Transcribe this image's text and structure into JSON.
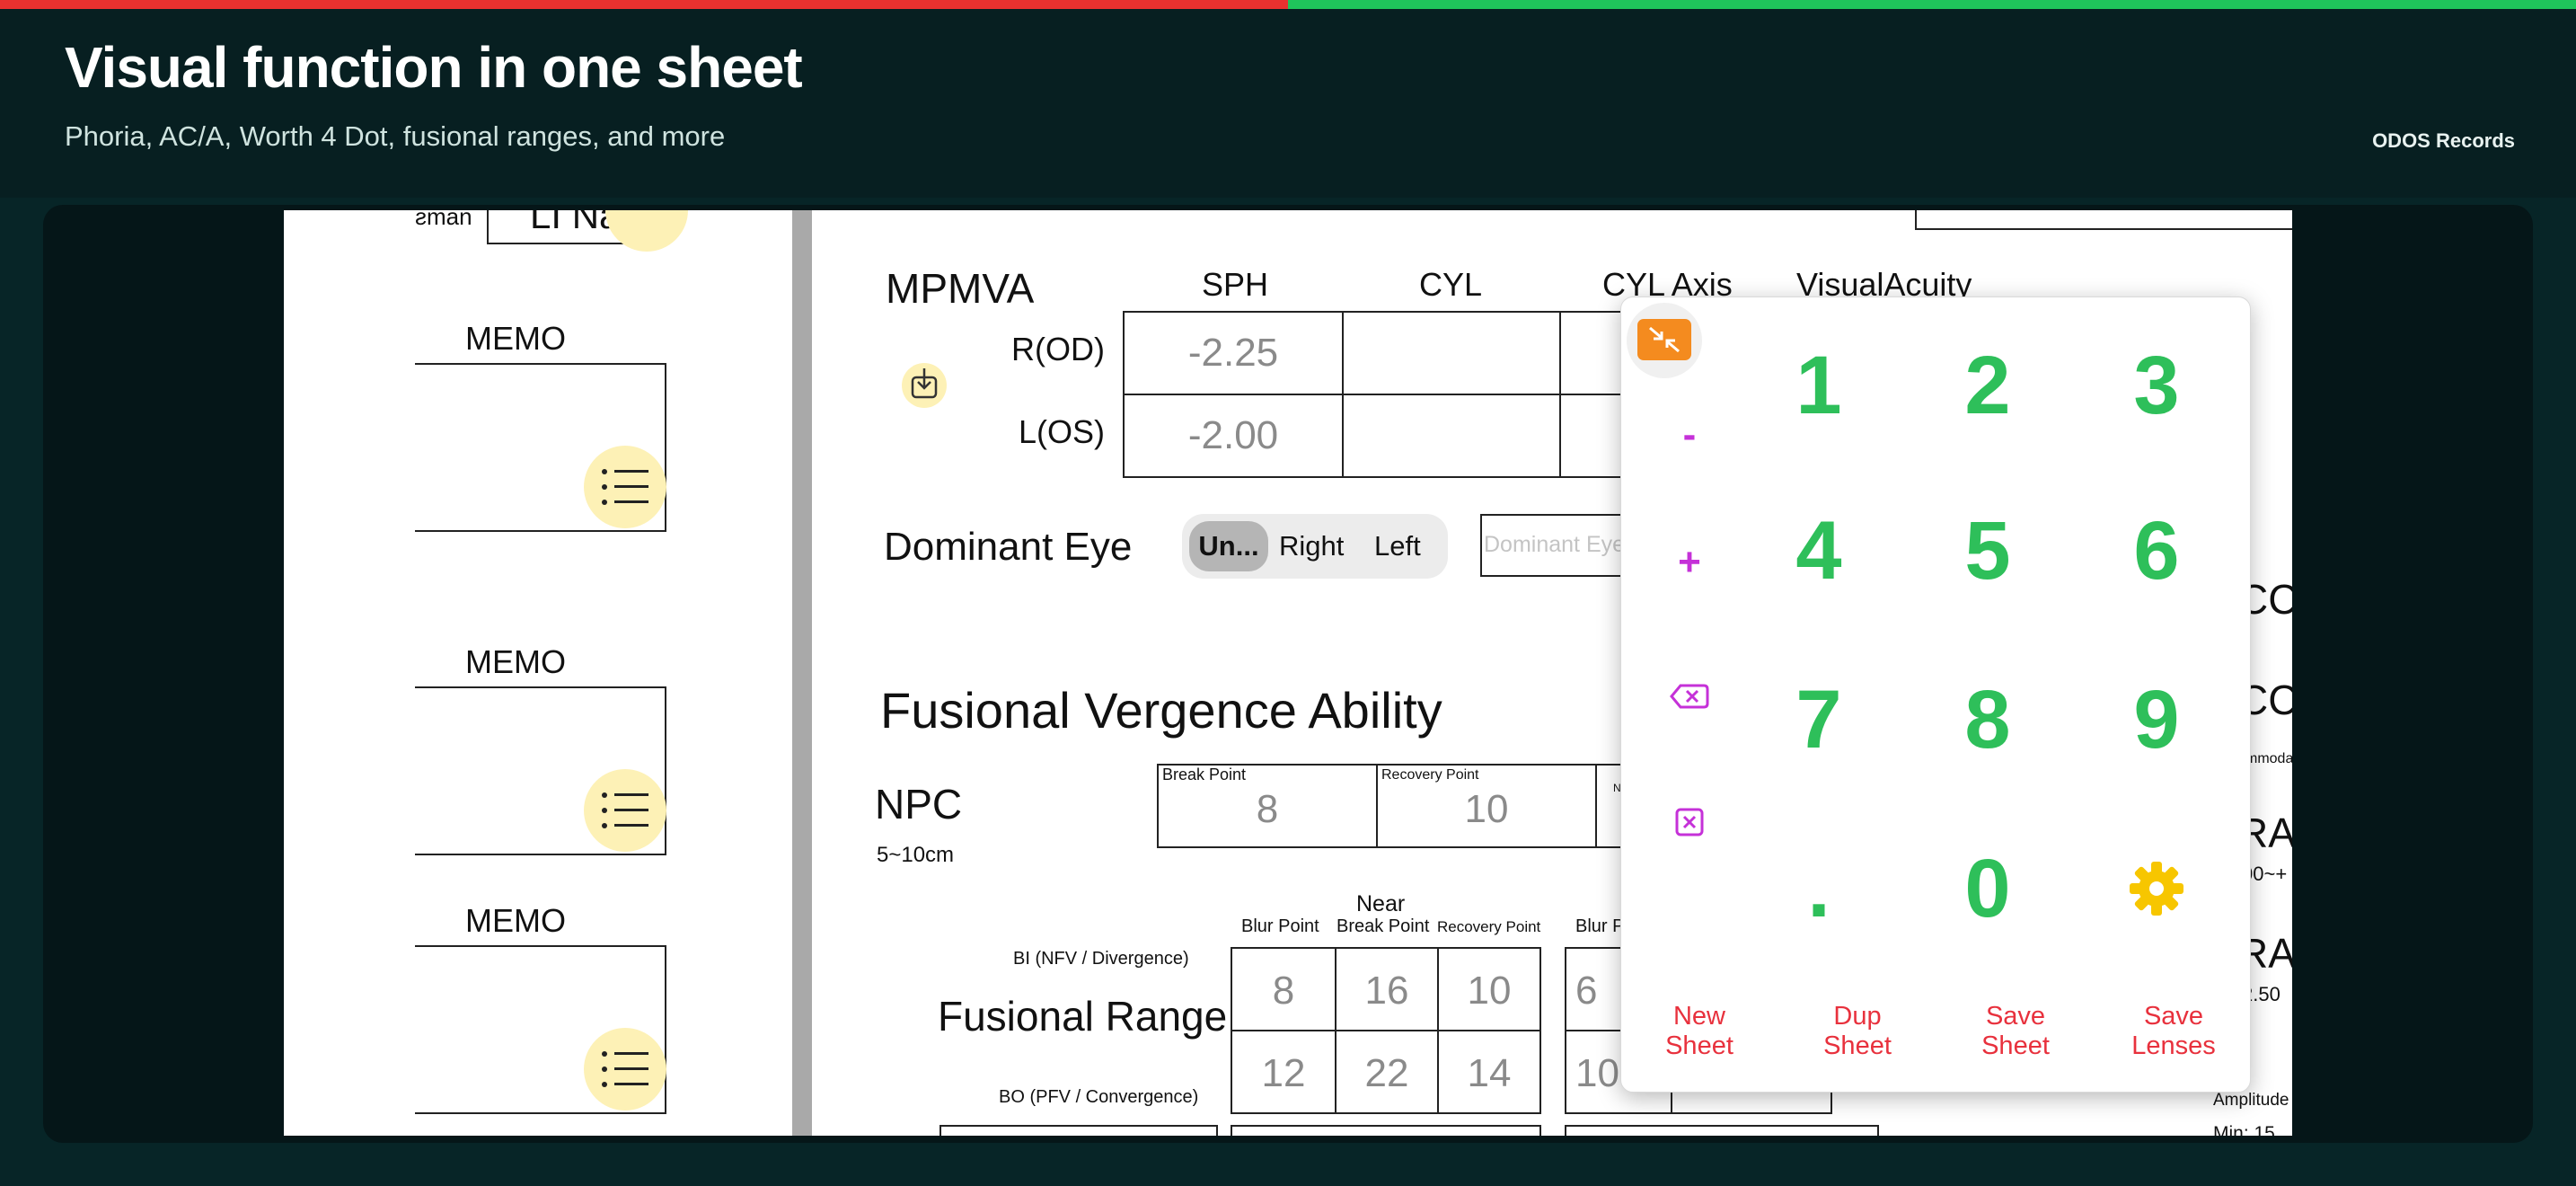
{
  "header": {
    "title": "Visual function in one sheet",
    "subtitle": "Phoria, AC/A, Worth 4 Dot, fusional ranges, and more",
    "records_link": "ODOS Records"
  },
  "colors": {
    "accent_red": "#e8312f",
    "accent_green": "#1fc45b",
    "key_green": "#2ebf5a",
    "action_red": "#e8313d",
    "side_purple": "#c531d8",
    "gear_yellow": "#f7c600"
  },
  "left_panel": {
    "top_partial_label": "ƨman",
    "top_partial_value": "LI Na",
    "memos": [
      {
        "label": "MEMO"
      },
      {
        "label": "MEMO"
      },
      {
        "label": "MEMO"
      }
    ]
  },
  "mpmva": {
    "title": "MPMVA",
    "headers": [
      "SPH",
      "CYL",
      "CYL Axis",
      "VisualAcuity"
    ],
    "rows": [
      {
        "eye": "R(OD)",
        "sph": "-2.25"
      },
      {
        "eye": "L(OS)",
        "sph": "-2.00"
      }
    ]
  },
  "dominant_eye": {
    "label": "Dominant Eye",
    "options": [
      "Un...",
      "Right",
      "Left"
    ],
    "selected": "Un...",
    "input_placeholder": "Dominant Eye"
  },
  "fusional": {
    "section_title": "Fusional Vergence Ability",
    "npc": {
      "label": "NPC",
      "range": "5~10cm",
      "break_label": "Break Point",
      "break_value": "8",
      "recovery_label": "Recovery Point",
      "recovery_value": "10",
      "note_partial": "N t br"
    },
    "range": {
      "title": "Fusional Range",
      "near_label": "Near",
      "col_headers": [
        "Blur Point",
        "Break Point",
        "Recovery Point"
      ],
      "partial_header": "Blur P",
      "bi_label": "BI (NFV / Divergence)",
      "bo_label": "BO (PFV / Convergence)",
      "bi_values": [
        "8",
        "16",
        "10"
      ],
      "bo_values": [
        "12",
        "22",
        "14"
      ],
      "partial_bi": "6",
      "partial_bo": "10"
    }
  },
  "right_partial": {
    "lines": [
      "CC",
      "CC",
      "mmoda",
      "RA",
      "00~+",
      "RA",
      "2.50",
      "Amplitude",
      "Min: 15"
    ]
  },
  "keypad": {
    "collapse_icon": "collapse-arrows-icon",
    "keys": [
      "1",
      "2",
      "3",
      "4",
      "5",
      "6",
      "7",
      "8",
      "9",
      ".",
      "0"
    ],
    "side_keys": {
      "minus": "-",
      "plus": "+"
    },
    "actions": [
      {
        "line1": "New",
        "line2": "Sheet"
      },
      {
        "line1": "Dup",
        "line2": "Sheet"
      },
      {
        "line1": "Save",
        "line2": "Sheet"
      },
      {
        "line1": "Save",
        "line2": "Lenses"
      }
    ]
  }
}
